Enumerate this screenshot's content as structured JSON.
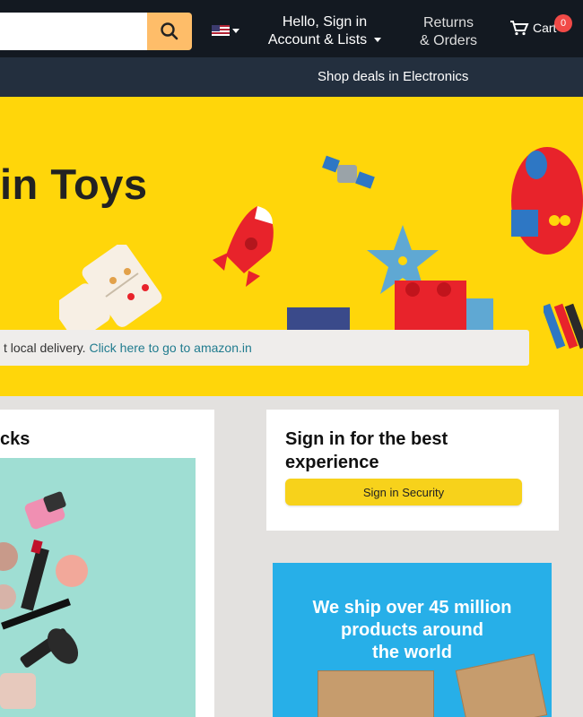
{
  "header": {
    "search": {
      "value": "",
      "placeholder": ""
    },
    "account": {
      "greeting": "Hello, Sign in",
      "label": "Account & Lists"
    },
    "returns": {
      "line1": "Returns",
      "line2": "& Orders"
    },
    "cart": {
      "label": "Cart",
      "count": "0"
    }
  },
  "subnav": {
    "deal_link": "Shop deals in Electronics"
  },
  "hero": {
    "title": "in Toys",
    "notice_text": "t local delivery. ",
    "notice_link": "Click here to go to amazon.in"
  },
  "cards": {
    "left_title": "cks",
    "signin": {
      "title": "Sign in for the best experience",
      "button": "Sign in Security"
    },
    "ship": {
      "line1": "We ship over 45 million",
      "line2": "products around",
      "line3": "the world"
    }
  },
  "colors": {
    "header_bg": "#131921",
    "subnav_bg": "#232f3e",
    "hero_bg": "#ffd60a",
    "search_button": "#febd69",
    "signin_button": "#f7d21b",
    "ship_bg": "#27afe8"
  }
}
